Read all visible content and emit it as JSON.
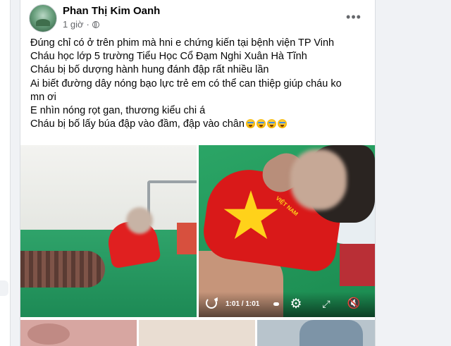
{
  "post": {
    "author": "Phan Thị Kim Oanh",
    "time": "1 giờ",
    "separator": "·",
    "privacy_icon": "globe-icon",
    "more_icon": "more-options-icon",
    "lines": [
      "Đúng chỉ có ở trên phim mà hni e chứng kiến tại bệnh viện TP Vinh",
      "Cháu học lớp 5 trường Tiểu Học Cổ Đạm Nghi Xuân Hà Tĩnh",
      "Cháu bị bố dượng hành hung đánh đập rất nhiều lần",
      "Ai biết đường dây nóng bạo lực trẻ em có thể can thiệp giúp cháu ko",
      "mn ơi",
      "E nhìn nóng rọt gan, thương kiểu chi á",
      "Cháu bị bố lấy búa đập vào đầm, đập vào chân"
    ],
    "emoji_count": 4,
    "emoji_name": "crying-face-emoji"
  },
  "video": {
    "time": "1:01 / 1:01",
    "shirt_text": "VIỆT NAM",
    "gear_icon": "⚙",
    "expand_icon": "⤢",
    "speaker_icon": "🔇"
  }
}
